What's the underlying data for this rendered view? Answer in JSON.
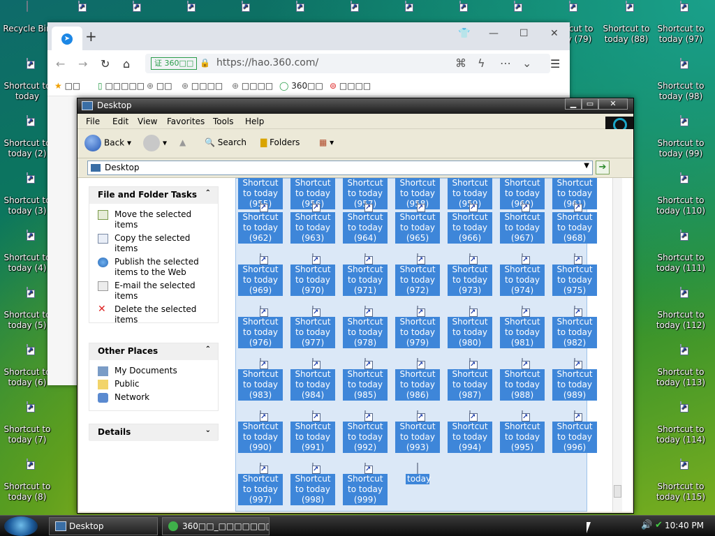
{
  "desktop": {
    "recycle_bin": "Recycle Bin",
    "left_col": [
      "Shortcut to today",
      "Shortcut to today (2)",
      "Shortcut to today (3)",
      "Shortcut to today (4)",
      "Shortcut to today (5)",
      "Shortcut to today (6)",
      "Shortcut to today (7)",
      "Shortcut to today (8)"
    ],
    "col79": "Shortcut to today (79)",
    "right_col_a": [
      "Shortcut to today (88)"
    ],
    "right_col_b": [
      "Shortcut to today (97)",
      "Shortcut to today (98)",
      "Shortcut to today (99)",
      "Shortcut to today (110)",
      "Shortcut to today (111)",
      "Shortcut to today (112)",
      "Shortcut to today (113)",
      "Shortcut to today (114)",
      "Shortcut to today (115)"
    ]
  },
  "browser": {
    "url_badge": "证 360□□",
    "url": "https://hao.360.com/",
    "bookmarks": [
      "□□",
      "□□□□□",
      "□□",
      "□□□□",
      "□□□□",
      "360□□",
      "□□□□"
    ]
  },
  "explorer": {
    "title": "Desktop",
    "menu": [
      "File",
      "Edit",
      "View",
      "Favorites",
      "Tools",
      "Help"
    ],
    "toolbar": {
      "back": "Back",
      "search": "Search",
      "folders": "Folders"
    },
    "address": "Desktop",
    "tasks_title": "File and Folder Tasks",
    "tasks": [
      "Move the selected items",
      "Copy the selected items",
      "Publish the selected items to the Web",
      "E-mail the selected items",
      "Delete the selected items"
    ],
    "places_title": "Other Places",
    "places": [
      "My Documents",
      "Public",
      "Network"
    ],
    "details_title": "Details",
    "files": [
      "Shortcut to today (955)",
      "Shortcut to today (956)",
      "Shortcut to today (957)",
      "Shortcut to today (958)",
      "Shortcut to today (959)",
      "Shortcut to today (960)",
      "Shortcut to today (961)",
      "Shortcut to today (962)",
      "Shortcut to today (963)",
      "Shortcut to today (964)",
      "Shortcut to today (965)",
      "Shortcut to today (966)",
      "Shortcut to today (967)",
      "Shortcut to today (968)",
      "Shortcut to today (969)",
      "Shortcut to today (970)",
      "Shortcut to today (971)",
      "Shortcut to today (972)",
      "Shortcut to today (973)",
      "Shortcut to today (974)",
      "Shortcut to today (975)",
      "Shortcut to today (976)",
      "Shortcut to today (977)",
      "Shortcut to today (978)",
      "Shortcut to today (979)",
      "Shortcut to today (980)",
      "Shortcut to today (981)",
      "Shortcut to today (982)",
      "Shortcut to today (983)",
      "Shortcut to today (984)",
      "Shortcut to today (985)",
      "Shortcut to today (986)",
      "Shortcut to today (987)",
      "Shortcut to today (988)",
      "Shortcut to today (989)",
      "Shortcut to today (990)",
      "Shortcut to today (991)",
      "Shortcut to today (992)",
      "Shortcut to today (993)",
      "Shortcut to today (994)",
      "Shortcut to today (995)",
      "Shortcut to today (996)",
      "Shortcut to today (997)",
      "Shortcut to today (998)",
      "Shortcut to today (999)",
      "today"
    ]
  },
  "taskbar": {
    "items": [
      "Desktop",
      "360□□_□□□□□□□□..."
    ],
    "clock": "10:40 PM"
  }
}
